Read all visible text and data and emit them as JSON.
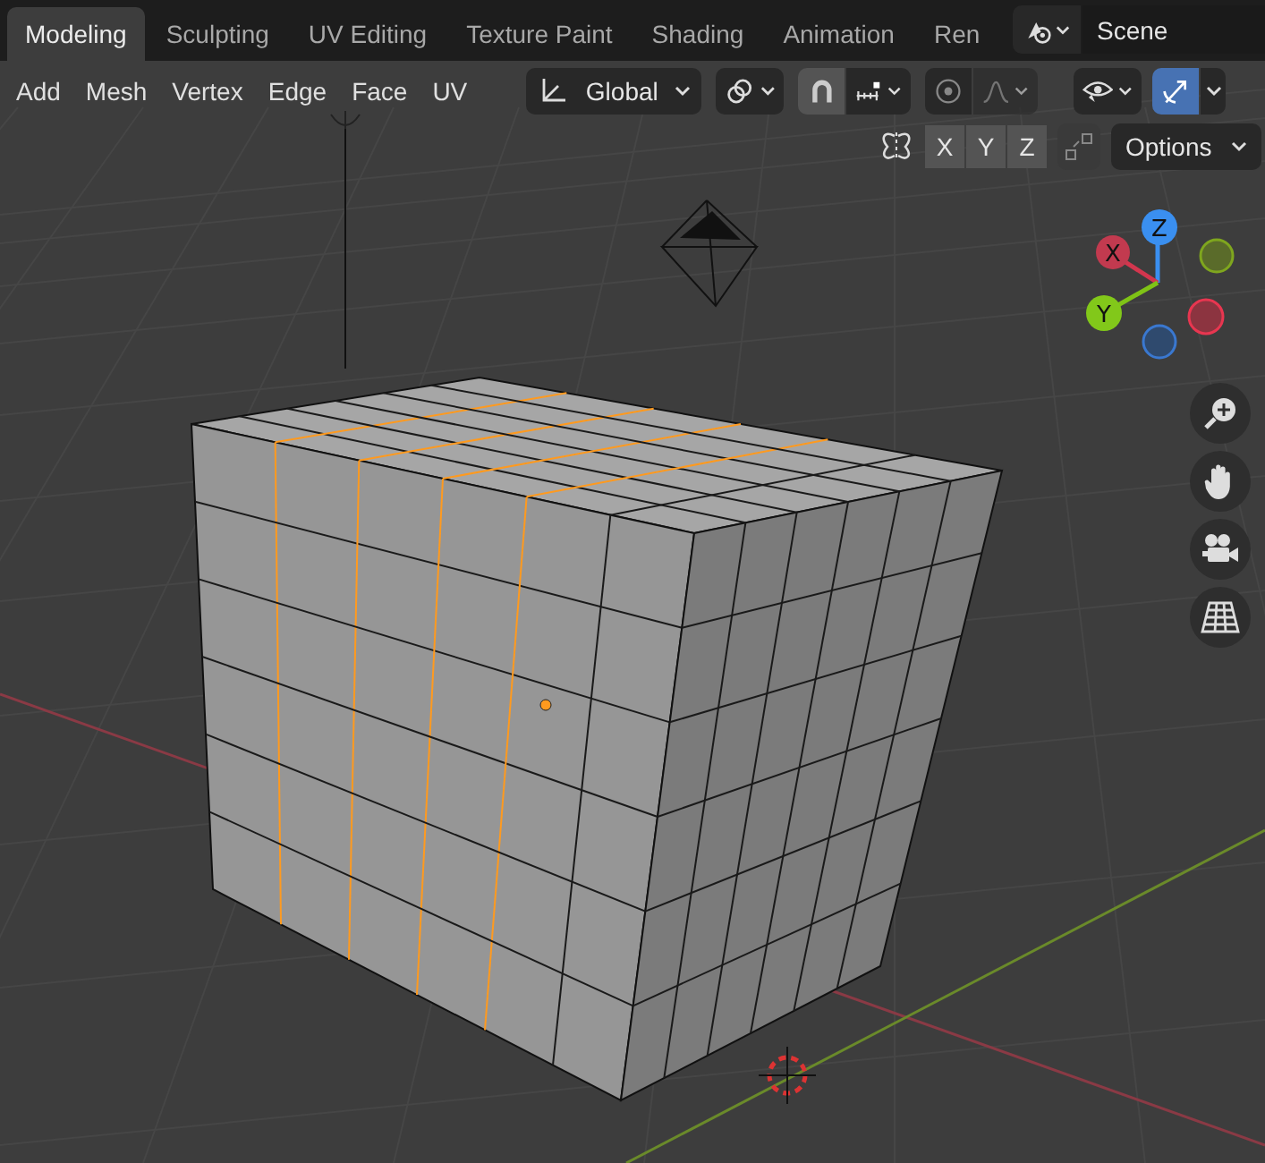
{
  "tabs": [
    {
      "label": "Modeling",
      "selected": true
    },
    {
      "label": "Sculpting",
      "selected": false
    },
    {
      "label": "UV Editing",
      "selected": false
    },
    {
      "label": "Texture Paint",
      "selected": false
    },
    {
      "label": "Shading",
      "selected": false
    },
    {
      "label": "Animation",
      "selected": false
    },
    {
      "label": "Ren",
      "selected": false
    }
  ],
  "scene": {
    "value": "Scene"
  },
  "menus": [
    "Add",
    "Mesh",
    "Vertex",
    "Edge",
    "Face",
    "UV"
  ],
  "orientation": {
    "value": "Global"
  },
  "snap": {
    "on": true
  },
  "proportional_editing": {
    "on": false
  },
  "gizmo": {
    "on": true
  },
  "mirror": [
    {
      "label": "X",
      "on": false
    },
    {
      "label": "Y",
      "on": false
    },
    {
      "label": "Z",
      "on": false
    }
  ],
  "options": {
    "label": "Options"
  },
  "axis_labels": [
    "Z",
    "X",
    "Y"
  ]
}
